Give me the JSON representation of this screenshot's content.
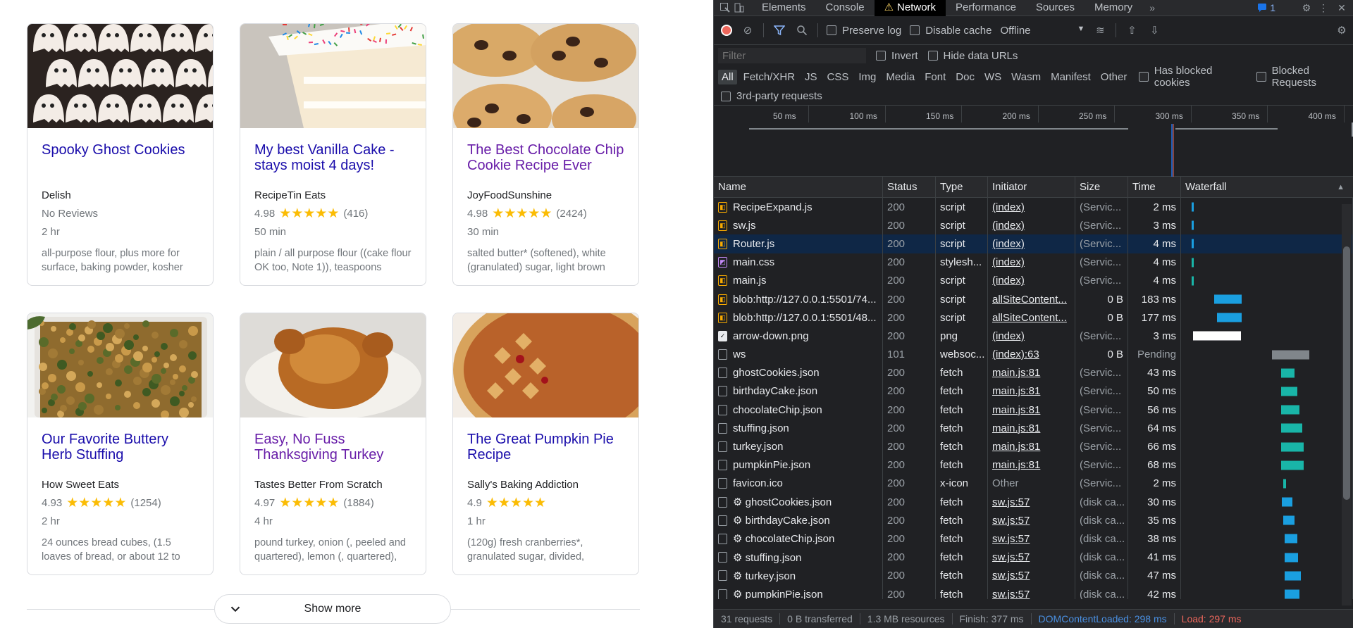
{
  "cards": [
    {
      "title": "Spooky Ghost Cookies",
      "source": "Delish",
      "rating": "No Reviews",
      "stars": "",
      "count": "",
      "time": "2 hr",
      "ingredients": "all-purpose flour, plus more for surface, baking powder, kosher",
      "visited": false,
      "img": "ghosts"
    },
    {
      "title": "My best Vanilla Cake - stays moist 4 days!",
      "source": "RecipeTin Eats",
      "rating": "4.98",
      "stars": "★★★★★",
      "count": "(416)",
      "time": "50 min",
      "ingredients": "plain / all purpose flour ((cake flour OK too, Note 1)), teaspoons",
      "visited": false,
      "img": "cake"
    },
    {
      "title": "The Best Chocolate Chip Cookie Recipe Ever",
      "source": "JoyFoodSunshine",
      "rating": "4.98",
      "stars": "★★★★★",
      "count": "(2424)",
      "time": "30 min",
      "ingredients": "salted butter* (softened), white (granulated) sugar, light brown",
      "visited": true,
      "img": "cookies"
    },
    {
      "title": "Our Favorite Buttery Herb Stuffing",
      "source": "How Sweet Eats",
      "rating": "4.93",
      "stars": "★★★★★",
      "count": "(1254)",
      "time": "2 hr",
      "ingredients": "24 ounces bread cubes, (1.5 loaves of bread, or about 12 to",
      "visited": false,
      "img": "stuffing"
    },
    {
      "title": "Easy, No Fuss Thanksgiving Turkey",
      "source": "Tastes Better From Scratch",
      "rating": "4.97",
      "stars": "★★★★★",
      "count": "(1884)",
      "time": "4 hr",
      "ingredients": "pound turkey, onion (, peeled and quartered), lemon (, quartered),",
      "visited": true,
      "img": "turkey"
    },
    {
      "title": "The Great Pumpkin Pie Recipe",
      "source": "Sally's Baking Addiction",
      "rating": "4.9",
      "stars": "★★★★★",
      "count": "",
      "time": "1 hr",
      "ingredients": "(120g) fresh cranberries*, granulated sugar, divided,",
      "visited": false,
      "img": "pie"
    }
  ],
  "show_more": "Show more",
  "devtools": {
    "tabs": [
      "Elements",
      "Console",
      "Network",
      "Performance",
      "Sources",
      "Memory"
    ],
    "active_tab": "Network",
    "issues_count": "1",
    "preserve_log": "Preserve log",
    "disable_cache": "Disable cache",
    "throttle": "Offline",
    "filter_placeholder": "Filter",
    "invert": "Invert",
    "hide_data_urls": "Hide data URLs",
    "types": [
      "All",
      "Fetch/XHR",
      "JS",
      "CSS",
      "Img",
      "Media",
      "Font",
      "Doc",
      "WS",
      "Wasm",
      "Manifest",
      "Other"
    ],
    "has_blocked_cookies": "Has blocked cookies",
    "blocked_requests": "Blocked Requests",
    "third_party": "3rd-party requests",
    "ticks": [
      "50 ms",
      "100 ms",
      "150 ms",
      "200 ms",
      "250 ms",
      "300 ms",
      "350 ms",
      "400 ms"
    ],
    "columns": [
      "Name",
      "Status",
      "Type",
      "Initiator",
      "Size",
      "Time",
      "Waterfall"
    ],
    "rows": [
      {
        "name": "RecipeExpand.js",
        "status": "200",
        "type": "script",
        "initiator": "(index)",
        "size": "(Servic...",
        "time": "2 ms",
        "icon": "js",
        "wf_start": 0.04,
        "wf_len": 0.01,
        "wf_color": "#1a9fe0"
      },
      {
        "name": "sw.js",
        "status": "200",
        "type": "script",
        "initiator": "(index)",
        "size": "(Servic...",
        "time": "3 ms",
        "icon": "js",
        "wf_start": 0.04,
        "wf_len": 0.01,
        "wf_color": "#1a9fe0"
      },
      {
        "name": "Router.js",
        "status": "200",
        "type": "script",
        "initiator": "(index)",
        "size": "(Servic...",
        "time": "4 ms",
        "icon": "js",
        "wf_start": 0.04,
        "wf_len": 0.01,
        "wf_color": "#1a9fe0",
        "selected": true
      },
      {
        "name": "main.css",
        "status": "200",
        "type": "stylesh...",
        "initiator": "(index)",
        "size": "(Servic...",
        "time": "4 ms",
        "icon": "css",
        "wf_start": 0.04,
        "wf_len": 0.01,
        "wf_color": "#19b5a8"
      },
      {
        "name": "main.js",
        "status": "200",
        "type": "script",
        "initiator": "(index)",
        "size": "(Servic...",
        "time": "4 ms",
        "icon": "js",
        "wf_start": 0.04,
        "wf_len": 0.01,
        "wf_color": "#19b5a8"
      },
      {
        "name": "blob:http://127.0.0.1:5501/74...",
        "status": "200",
        "type": "script",
        "initiator": "allSiteContent...",
        "size": "0 B",
        "time": "183 ms",
        "icon": "js",
        "wf_start": 0.22,
        "wf_len": 0.22,
        "wf_color": "#1a9fe0"
      },
      {
        "name": "blob:http://127.0.0.1:5501/48...",
        "status": "200",
        "type": "script",
        "initiator": "allSiteContent...",
        "size": "0 B",
        "time": "177 ms",
        "icon": "js",
        "wf_start": 0.24,
        "wf_len": 0.2,
        "wf_color": "#1a9fe0"
      },
      {
        "name": "arrow-down.png",
        "status": "200",
        "type": "png",
        "initiator": "(index)",
        "size": "(Servic...",
        "time": "3 ms",
        "icon": "img",
        "wf_start": 0.05,
        "wf_len": 0.38,
        "wf_color": "#ffffff"
      },
      {
        "name": "ws",
        "status": "101",
        "type": "websoc...",
        "initiator": "(index):63",
        "size": "0 B",
        "time": "Pending",
        "icon": "",
        "wf_start": 0.68,
        "wf_len": 0.3,
        "wf_color": "#80868b"
      },
      {
        "name": "ghostCookies.json",
        "status": "200",
        "type": "fetch",
        "initiator": "main.js:81",
        "size": "(Servic...",
        "time": "43 ms",
        "icon": "",
        "wf_start": 0.75,
        "wf_len": 0.11,
        "wf_color": "#19b5a8"
      },
      {
        "name": "birthdayCake.json",
        "status": "200",
        "type": "fetch",
        "initiator": "main.js:81",
        "size": "(Servic...",
        "time": "50 ms",
        "icon": "",
        "wf_start": 0.75,
        "wf_len": 0.13,
        "wf_color": "#19b5a8"
      },
      {
        "name": "chocolateChip.json",
        "status": "200",
        "type": "fetch",
        "initiator": "main.js:81",
        "size": "(Servic...",
        "time": "56 ms",
        "icon": "",
        "wf_start": 0.75,
        "wf_len": 0.15,
        "wf_color": "#19b5a8"
      },
      {
        "name": "stuffing.json",
        "status": "200",
        "type": "fetch",
        "initiator": "main.js:81",
        "size": "(Servic...",
        "time": "64 ms",
        "icon": "",
        "wf_start": 0.75,
        "wf_len": 0.17,
        "wf_color": "#19b5a8"
      },
      {
        "name": "turkey.json",
        "status": "200",
        "type": "fetch",
        "initiator": "main.js:81",
        "size": "(Servic...",
        "time": "66 ms",
        "icon": "",
        "wf_start": 0.75,
        "wf_len": 0.18,
        "wf_color": "#19b5a8"
      },
      {
        "name": "pumpkinPie.json",
        "status": "200",
        "type": "fetch",
        "initiator": "main.js:81",
        "size": "(Servic...",
        "time": "68 ms",
        "icon": "",
        "wf_start": 0.75,
        "wf_len": 0.18,
        "wf_color": "#19b5a8"
      },
      {
        "name": "favicon.ico",
        "status": "200",
        "type": "x-icon",
        "initiator": "Other",
        "size": "(Servic...",
        "time": "2 ms",
        "icon": "",
        "wf_start": 0.77,
        "wf_len": 0.02,
        "wf_color": "#19b5a8"
      },
      {
        "name": "⚙ ghostCookies.json",
        "status": "200",
        "type": "fetch",
        "initiator": "sw.js:57",
        "size": "(disk ca...",
        "time": "30 ms",
        "icon": "",
        "wf_start": 0.76,
        "wf_len": 0.08,
        "wf_color": "#1a9fe0"
      },
      {
        "name": "⚙ birthdayCake.json",
        "status": "200",
        "type": "fetch",
        "initiator": "sw.js:57",
        "size": "(disk ca...",
        "time": "35 ms",
        "icon": "",
        "wf_start": 0.77,
        "wf_len": 0.09,
        "wf_color": "#1a9fe0"
      },
      {
        "name": "⚙ chocolateChip.json",
        "status": "200",
        "type": "fetch",
        "initiator": "sw.js:57",
        "size": "(disk ca...",
        "time": "38 ms",
        "icon": "",
        "wf_start": 0.78,
        "wf_len": 0.1,
        "wf_color": "#1a9fe0"
      },
      {
        "name": "⚙ stuffing.json",
        "status": "200",
        "type": "fetch",
        "initiator": "sw.js:57",
        "size": "(disk ca...",
        "time": "41 ms",
        "icon": "",
        "wf_start": 0.78,
        "wf_len": 0.11,
        "wf_color": "#1a9fe0"
      },
      {
        "name": "⚙ turkey.json",
        "status": "200",
        "type": "fetch",
        "initiator": "sw.js:57",
        "size": "(disk ca...",
        "time": "47 ms",
        "icon": "",
        "wf_start": 0.78,
        "wf_len": 0.13,
        "wf_color": "#1a9fe0"
      },
      {
        "name": "⚙ pumpkinPie.json",
        "status": "200",
        "type": "fetch",
        "initiator": "sw.js:57",
        "size": "(disk ca...",
        "time": "42 ms",
        "icon": "",
        "wf_start": 0.78,
        "wf_len": 0.12,
        "wf_color": "#1a9fe0"
      }
    ],
    "status": {
      "requests": "31 requests",
      "transferred": "0 B transferred",
      "resources": "1.3 MB resources",
      "finish": "Finish: 377 ms",
      "dcl": "DOMContentLoaded: 298 ms",
      "load": "Load: 297 ms"
    }
  }
}
